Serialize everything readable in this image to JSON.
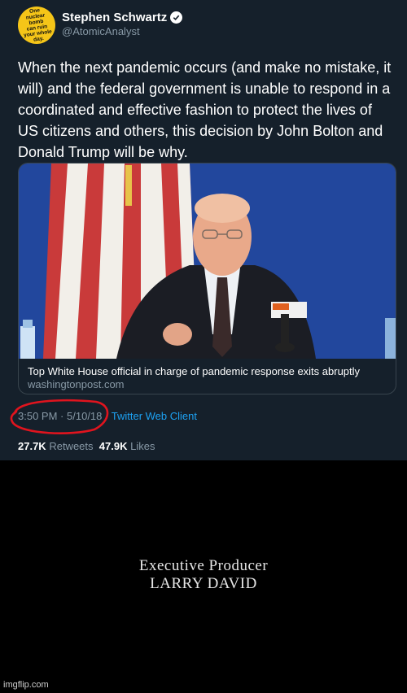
{
  "tweet": {
    "avatar_text": "One\nnuclear\nbomb\ncan ruin\nyour whole\nday.",
    "display_name": "Stephen Schwartz",
    "handle": "@AtomicAnalyst",
    "text": "When the next pandemic occurs (and make no mistake, it will) and the federal government is unable to respond in a coordinated and effective fashion to protect the lives of US citizens and others, this decision by John Bolton and Donald Trump will be why.",
    "card": {
      "title": "Top White House official in charge of pandemic response exits abruptly",
      "domain": "washingtonpost.com",
      "mic_label": "mic"
    },
    "time": "3:50 PM",
    "date": "5/10/18",
    "separator": "·",
    "client": "Twitter Web Client",
    "retweets_count": "27.7K",
    "retweets_label": "Retweets",
    "likes_count": "47.9K",
    "likes_label": "Likes"
  },
  "credits": {
    "line1": "Executive Producer",
    "line2": "LARRY DAVID"
  },
  "watermark": "imgflip.com",
  "colors": {
    "tweet_bg": "#15202b",
    "link_blue": "#1da1f2",
    "muted": "#8899a6",
    "annotation_red": "#e0141e",
    "avatar_yellow": "#f5c518"
  }
}
